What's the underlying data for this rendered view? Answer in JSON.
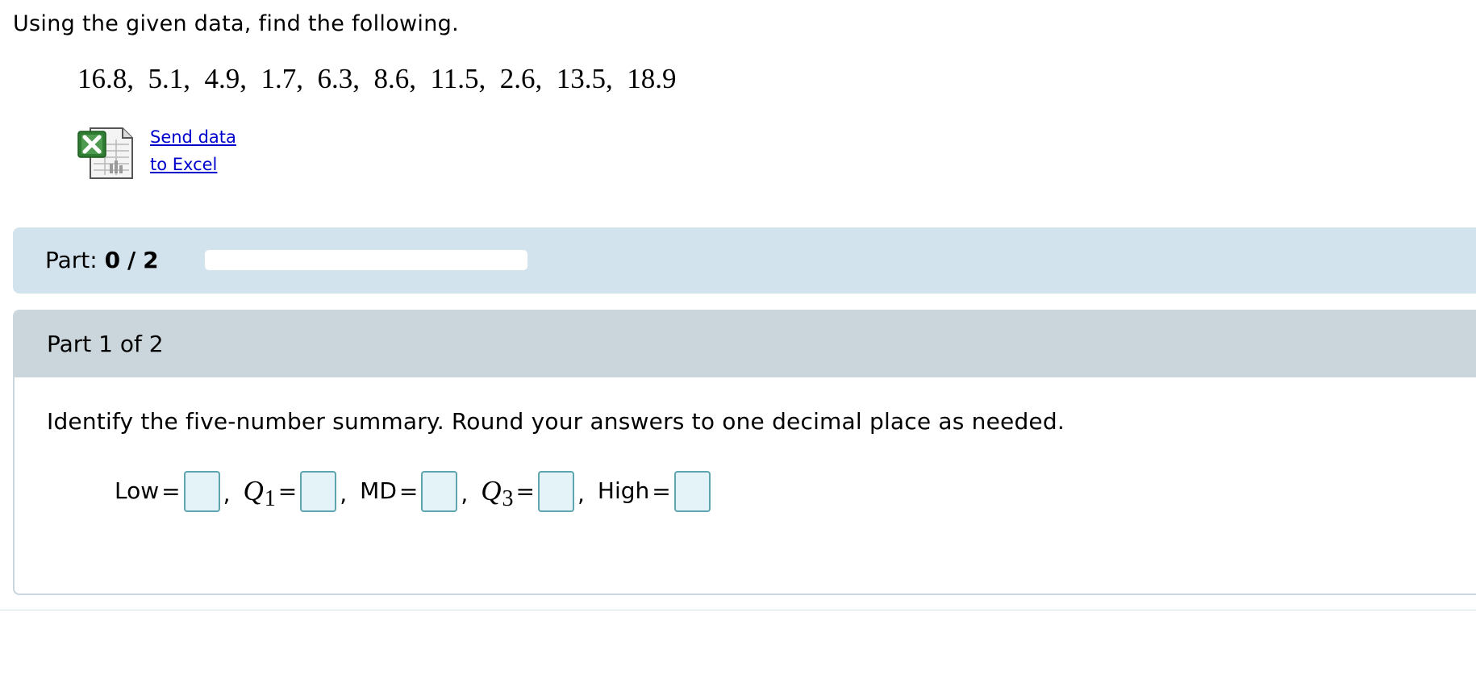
{
  "instruction": "Using the given data, find the following.",
  "data_values": "16.8,  5.1,  4.9,  1.7,  6.3,  8.6,  11.5,  2.6,  13.5,  18.9",
  "excel": {
    "icon": "excel-spreadsheet-icon",
    "link_line1": "Send data",
    "link_line2": "to Excel",
    "link_color": "#0000cc"
  },
  "progress": {
    "label": "Part:",
    "current": "0",
    "separator": "/",
    "total": "2",
    "fraction": 0,
    "banner_color": "#d3e3ed"
  },
  "part": {
    "title": "Part 1 of 2",
    "question": "Identify the five-number summary. Round your answers to one decimal place as needed.",
    "fields": {
      "low_label": "Low",
      "q1_symbol": "Q",
      "q1_sub": "1",
      "md_label": "MD",
      "q3_symbol": "Q",
      "q3_sub": "3",
      "high_label": "High",
      "equals": "=",
      "comma": ",",
      "low_value": "",
      "q1_value": "",
      "md_value": "",
      "q3_value": "",
      "high_value": ""
    },
    "input_border_color": "#5ea5b0",
    "input_fill_color": "#e3f3f7"
  }
}
